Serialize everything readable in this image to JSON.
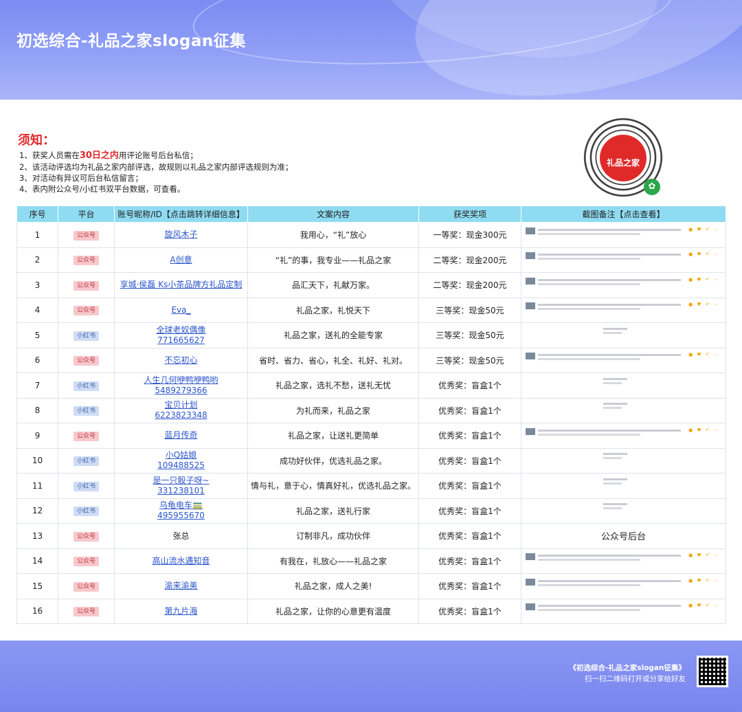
{
  "page": {
    "title": "初选综合-礼品之家slogan征集"
  },
  "notice": {
    "title": "须知：",
    "line1_pre": "1、获奖人员需在",
    "line1_highlight": "30日之内",
    "line1_post": "用评论账号后台私信；",
    "line2": "2、该活动评选均为礼品之家内部评选，故规则以礼品之家内部评选规则为准；",
    "line3": "3、对活动有异议可后台私信留言；",
    "line4": "4、表内附公众号/小红书双平台数据，可查看。",
    "qr_logo_text": "礼品之家"
  },
  "table": {
    "headers": [
      "序号",
      "平台",
      "账号昵称/ID【点击跳转详细信息】",
      "文案内容",
      "获奖奖项",
      "截图备注【点击查看】"
    ],
    "rows": [
      {
        "no": "1",
        "platform": "公众号",
        "acct": "旋风木子",
        "acct_id": "",
        "text": "我用心，“礼”放心",
        "prize": "一等奖：现金300元",
        "note": ""
      },
      {
        "no": "2",
        "platform": "公众号",
        "acct": "A创意",
        "acct_id": "",
        "text": "“礼”的事，我专业——礼品之家",
        "prize": "二等奖：现金200元",
        "note": ""
      },
      {
        "no": "3",
        "platform": "公众号",
        "acct": "享城·侯磊 Ks小茶品牌方礼品定制",
        "acct_id": "",
        "text": "品汇天下，礼献万家。",
        "prize": "二等奖：现金200元",
        "note": ""
      },
      {
        "no": "4",
        "platform": "公众号",
        "acct": "Eva_",
        "acct_id": "",
        "text": "礼品之家，礼悦天下",
        "prize": "三等奖：现金50元",
        "note": ""
      },
      {
        "no": "5",
        "platform": "小红书",
        "acct": "全球老奴偶像",
        "acct_id": "771665627",
        "text": "礼品之家，送礼的全能专家",
        "prize": "三等奖：现金50元",
        "note": ""
      },
      {
        "no": "6",
        "platform": "公众号",
        "acct": "不忘初心",
        "acct_id": "",
        "text": "省时、省力、省心，礼全、礼好、礼对。",
        "prize": "三等奖：现金50元",
        "note": ""
      },
      {
        "no": "7",
        "platform": "小红书",
        "acct": "人生几何咿鸭咿鸭哟",
        "acct_id": "5489279366",
        "text": "礼品之家，选礼不愁，送礼无忧",
        "prize": "优秀奖：盲盒1个",
        "note": ""
      },
      {
        "no": "8",
        "platform": "小红书",
        "acct": "宝贝计划",
        "acct_id": "6223823348",
        "text": "为礼而来，礼品之家",
        "prize": "优秀奖：盲盒1个",
        "note": ""
      },
      {
        "no": "9",
        "platform": "公众号",
        "acct": "蓝月传奇",
        "acct_id": "",
        "text": "礼品之家，让送礼更简单",
        "prize": "优秀奖：盲盒1个",
        "note": ""
      },
      {
        "no": "10",
        "platform": "小红书",
        "acct": "小Q姑娘",
        "acct_id": "109488525",
        "text": "成功好伙伴，优选礼品之家。",
        "prize": "优秀奖：盲盒1个",
        "note": ""
      },
      {
        "no": "11",
        "platform": "小红书",
        "acct": "是一只骰子呀~",
        "acct_id": "331238101",
        "text": "情与礼，意于心，情真好礼，优选礼品之家。",
        "prize": "优秀奖：盲盒1个",
        "note": ""
      },
      {
        "no": "12",
        "platform": "小红书",
        "acct": "乌龟电车🚃",
        "acct_id": "495955670",
        "text": "礼品之家，送礼行家",
        "prize": "优秀奖：盲盒1个",
        "note": ""
      },
      {
        "no": "13",
        "platform": "公众号",
        "acct": "张总",
        "acct_id": "",
        "text": "订制非凡，成功伙伴",
        "prize": "优秀奖：盲盒1个",
        "note": "公众号后台"
      },
      {
        "no": "14",
        "platform": "公众号",
        "acct": "高山流水遇知音",
        "acct_id": "",
        "text": "有我在，礼放心——礼品之家",
        "prize": "优秀奖：盲盒1个",
        "note": ""
      },
      {
        "no": "15",
        "platform": "公众号",
        "acct": "渝来渝美",
        "acct_id": "",
        "text": "礼品之家，成人之美!",
        "prize": "优秀奖：盲盒1个",
        "note": ""
      },
      {
        "no": "16",
        "platform": "公众号",
        "acct": "第九片海",
        "acct_id": "",
        "text": "礼品之家，让你的心意更有温度",
        "prize": "优秀奖：盲盒1个",
        "note": ""
      }
    ]
  },
  "footer": {
    "title": "《初选综合-礼品之家slogan征集》",
    "subtitle": "扫一扫二维码打开或分享给好友"
  },
  "colors": {
    "header": "#8d9cf6",
    "table_header": "#8fdcf2",
    "accent_red": "#e0272a",
    "link": "#2b55cc",
    "badge_gzh": "#f7c8cc",
    "badge_xhs": "#cfdcf5"
  }
}
